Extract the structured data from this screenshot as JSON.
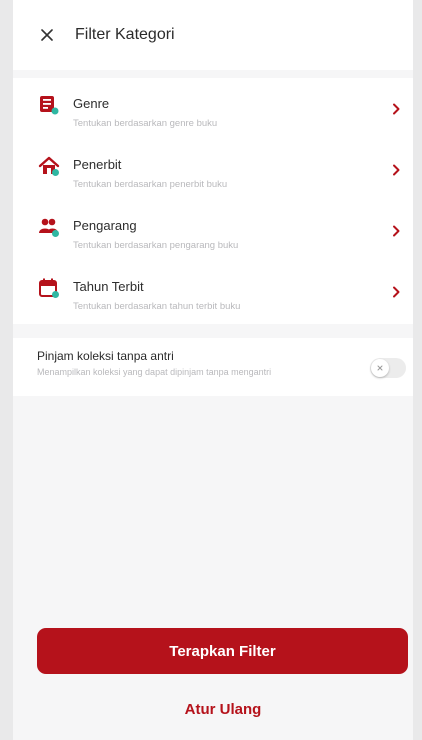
{
  "header": {
    "title": "Filter Kategori",
    "close_icon": "close-icon"
  },
  "categories": [
    {
      "label": "Genre",
      "description": "Tentukan berdasarkan genre buku",
      "icon": "book-icon"
    },
    {
      "label": "Penerbit",
      "description": "Tentukan berdasarkan penerbit buku",
      "icon": "house-icon"
    },
    {
      "label": "Pengarang",
      "description": "Tentukan berdasarkan pengarang buku",
      "icon": "people-icon"
    },
    {
      "label": "Tahun Terbit",
      "description": "Tentukan berdasarkan tahun terbit buku",
      "icon": "calendar-icon"
    }
  ],
  "toggle": {
    "title": "Pinjam koleksi tanpa antri",
    "subtitle": "Menampilkan koleksi yang dapat dipinjam tanpa mengantri",
    "state": "off"
  },
  "actions": {
    "apply_label": "Terapkan Filter",
    "reset_label": "Atur Ulang"
  },
  "colors": {
    "accent": "#b5121b",
    "icon_secondary": "#2fb7a2"
  }
}
